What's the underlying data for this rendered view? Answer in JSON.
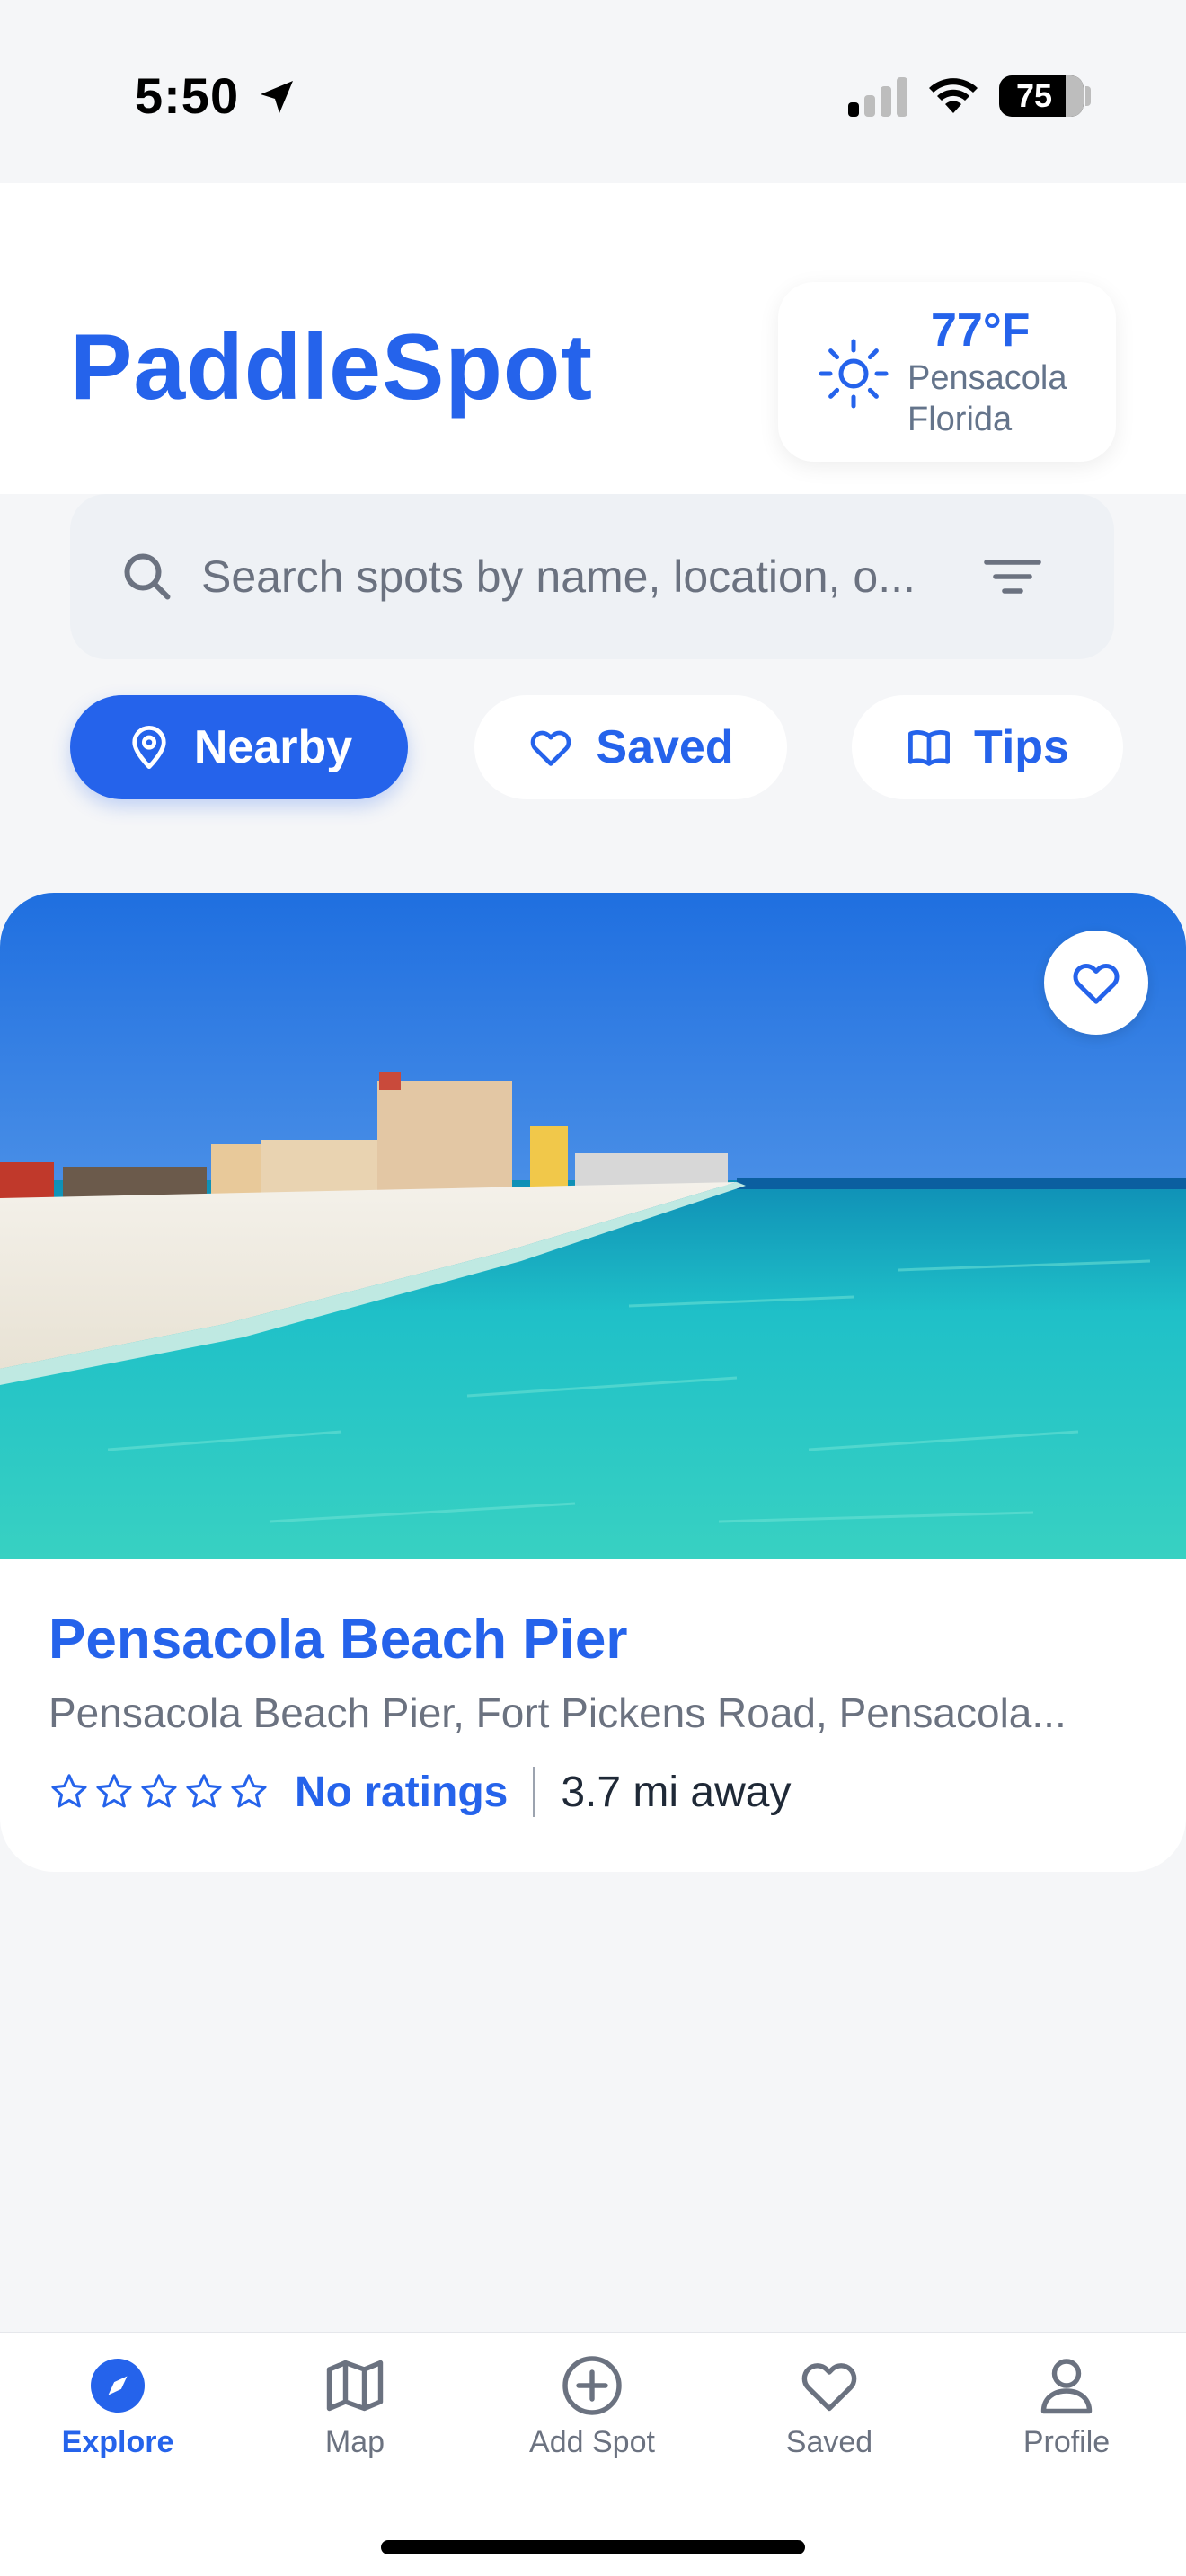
{
  "status_bar": {
    "time": "5:50",
    "battery": "75"
  },
  "header": {
    "title": "PaddleSpot"
  },
  "weather": {
    "temperature": "77°F",
    "city": "Pensacola",
    "state": "Florida"
  },
  "search": {
    "placeholder": "Search spots by name, location, o..."
  },
  "chips": [
    {
      "label": "Nearby",
      "icon": "location-pin-icon",
      "active": true
    },
    {
      "label": "Saved",
      "icon": "heart-icon",
      "active": false
    },
    {
      "label": "Tips",
      "icon": "book-icon",
      "active": false
    }
  ],
  "spot": {
    "name": "Pensacola Beach Pier",
    "address": "Pensacola Beach Pier, Fort Pickens Road, Pensacola...",
    "rating_text": "No ratings",
    "stars": 0,
    "distance": "3.7 mi away"
  },
  "nav": [
    {
      "label": "Explore",
      "icon": "compass-icon",
      "active": true
    },
    {
      "label": "Map",
      "icon": "map-icon",
      "active": false
    },
    {
      "label": "Add Spot",
      "icon": "plus-circle-icon",
      "active": false
    },
    {
      "label": "Saved",
      "icon": "heart-icon",
      "active": false
    },
    {
      "label": "Profile",
      "icon": "user-icon",
      "active": false
    }
  ],
  "colors": {
    "accent": "#2563eb",
    "muted": "#6b7280",
    "background": "#f5f6f8"
  }
}
